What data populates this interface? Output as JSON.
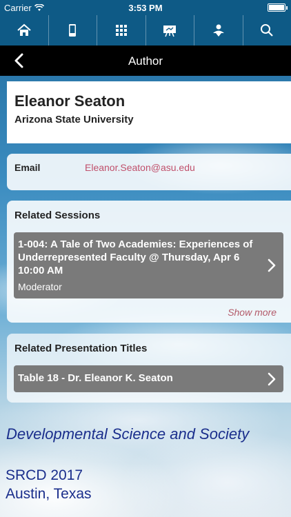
{
  "status_bar": {
    "carrier": "Carrier",
    "time": "3:53 PM"
  },
  "toolbar": {
    "items": [
      {
        "icon": "home-icon"
      },
      {
        "icon": "mobile-icon"
      },
      {
        "icon": "grid-icon"
      },
      {
        "icon": "presentation-icon"
      },
      {
        "icon": "person-icon"
      },
      {
        "icon": "search-icon"
      }
    ]
  },
  "nav": {
    "title": "Author"
  },
  "author": {
    "name": "Eleanor Seaton",
    "institution": "Arizona State University"
  },
  "email": {
    "label": "Email",
    "value": "Eleanor.Seaton@asu.edu"
  },
  "related_sessions": {
    "title": "Related Sessions",
    "items": [
      {
        "title": "1-004: A Tale of Two Academies: Experiences of Underrepresented Faculty @ Thursday, Apr 6 10:00 AM",
        "role": "Moderator"
      }
    ],
    "show_more": "Show more"
  },
  "related_presentations": {
    "title": "Related Presentation Titles",
    "items": [
      {
        "title": "Table 18 - Dr. Eleanor K. Seaton"
      }
    ]
  },
  "footer": {
    "tagline": "Developmental Science and Society",
    "conference": "SRCD 2017",
    "location": "Austin, Texas"
  }
}
